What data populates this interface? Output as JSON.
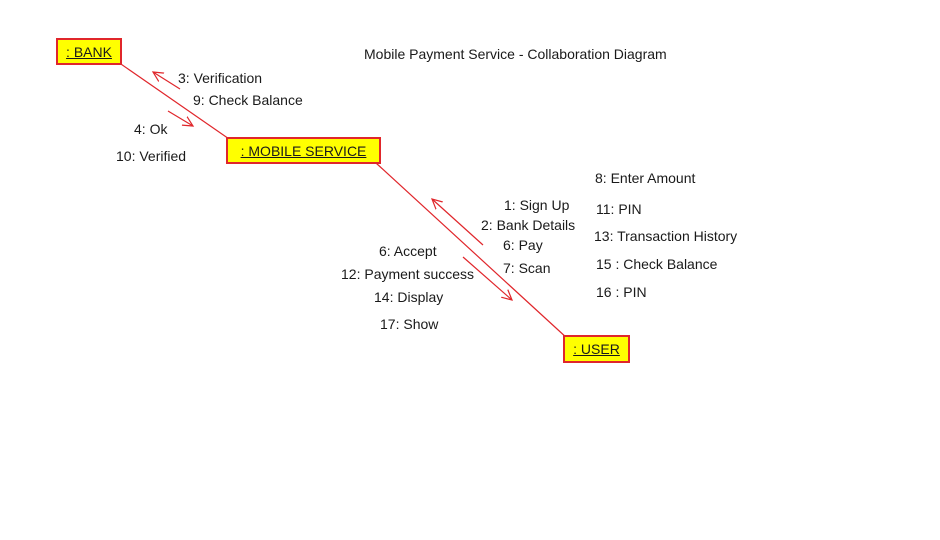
{
  "diagram": {
    "title": "Mobile Payment Service - Collaboration Diagram",
    "colors": {
      "object_fill": "#ffff00",
      "object_border": "#e0262b",
      "link": "#e0262b"
    },
    "objects": {
      "bank": ": BANK",
      "mobile_service": ": MOBILE SERVICE",
      "user": ": USER"
    },
    "bank_service_messages": {
      "to_bank": [
        "3: Verification",
        "9: Check Balance"
      ],
      "to_service": [
        "4: Ok",
        "10: Verified"
      ]
    },
    "service_user_messages": {
      "to_service": [
        "1: Sign Up",
        "2: Bank Details",
        "6: Pay",
        "7: Scan"
      ],
      "to_user": [
        "6: Accept",
        "12: Payment success",
        "14: Display",
        "17: Show"
      ],
      "user_side": [
        "8: Enter Amount",
        "11: PIN",
        "13: Transaction History",
        "15 : Check Balance",
        "16 : PIN"
      ]
    }
  }
}
